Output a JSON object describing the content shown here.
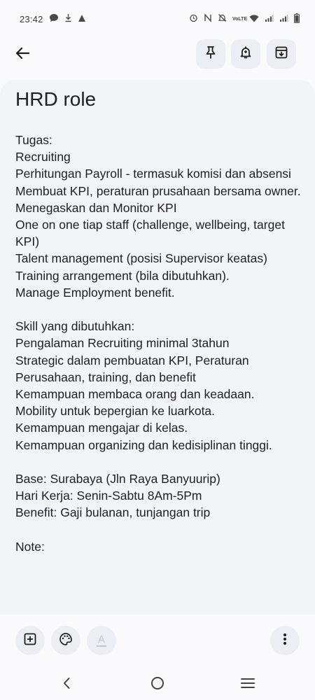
{
  "status_bar": {
    "time": "23:42",
    "left_icons": [
      "message-icon",
      "download-icon",
      "alert-icon"
    ],
    "right_icons": [
      "alarm-icon",
      "nfc-icon",
      "mute-icon",
      "volte-icon",
      "wifi-icon",
      "signal-icon",
      "signal-icon",
      "battery-icon"
    ],
    "volte_label": "VoLTE"
  },
  "toolbar": {
    "back_icon": "back-arrow-icon",
    "actions": [
      "pin-icon",
      "reminder-icon",
      "archive-icon"
    ]
  },
  "note": {
    "title": "HRD role",
    "body": "Tugas:\nRecruiting\nPerhitungan Payroll - termasuk komisi dan absensi\nMembuat KPI, peraturan prusahaan bersama owner.\nMenegaskan dan Monitor KPI\nOne on one tiap staff (challenge, wellbeing, target KPI)\nTalent management (posisi Supervisor keatas)\nTraining arrangement (bila dibutuhkan).\nManage Employment benefit.\n\nSkill yang dibutuhkan:\nPengalaman Recruiting minimal 3tahun\nStrategic dalam pembuatan KPI, Peraturan Perusahaan, training, dan benefit\nKemampuan membaca orang dan keadaan.\nMobility untuk bepergian ke luarkota.\nKemampuan mengajar di kelas.\nKemampuan organizing dan kedisiplinan tinggi.\n\nBase: Surabaya (Jln Raya Banyuurip)\nHari Kerja: Senin-Sabtu 8Am-5Pm\nBenefit: Gaji bulanan, tunjangan trip\n\nNote:"
  },
  "bottom_bar": {
    "actions": [
      "add-box-icon",
      "palette-icon",
      "text-format-icon",
      "more-vert-icon"
    ],
    "text_format_glyph": "A"
  },
  "nav_bar": {
    "buttons": [
      "nav-back-icon",
      "nav-home-icon",
      "nav-recents-icon"
    ]
  },
  "colors": {
    "background": "#fafafc",
    "note_card": "#f3f4f8",
    "button_bg": "#eceef3",
    "text": "#1f1f1f",
    "disabled_icon": "#c4c6cc"
  }
}
